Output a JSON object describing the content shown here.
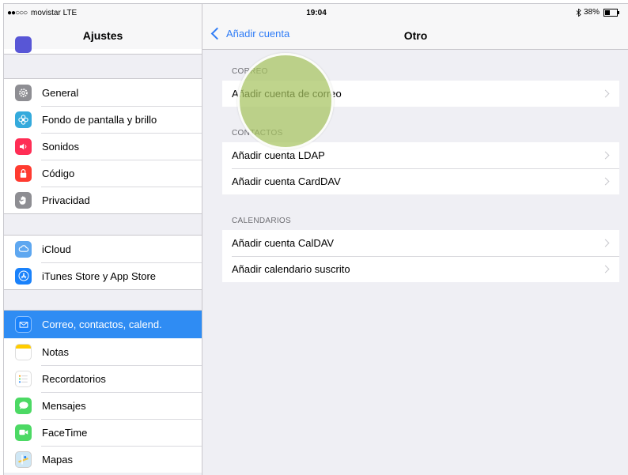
{
  "status_bar": {
    "carrier": "movistar",
    "network": "LTE",
    "time": "19:04",
    "battery": "38%",
    "battery_level": 0.38
  },
  "left_pane": {
    "title": "Ajustes",
    "groups": [
      {
        "items": [
          {
            "label": "General",
            "icon": "gear-icon",
            "color": "#8e8e93"
          },
          {
            "label": "Fondo de pantalla y brillo",
            "icon": "flower-icon",
            "color": "#34aadc"
          },
          {
            "label": "Sonidos",
            "icon": "speaker-icon",
            "color": "#ff2d55"
          },
          {
            "label": "Código",
            "icon": "lock-icon",
            "color": "#ff3b30"
          },
          {
            "label": "Privacidad",
            "icon": "hand-icon",
            "color": "#8e8e93"
          }
        ]
      },
      {
        "items": [
          {
            "label": "iCloud",
            "icon": "cloud-icon",
            "color": "#5ea7f0"
          },
          {
            "label": "iTunes Store y App Store",
            "icon": "appstore-icon",
            "color": "#1a82fb"
          }
        ]
      },
      {
        "items": [
          {
            "label": "Correo, contactos, calend.",
            "icon": "mail-icon",
            "color": "#1a82fb",
            "selected": true
          },
          {
            "label": "Notas",
            "icon": "notes-icon",
            "color": "#ffcc00"
          },
          {
            "label": "Recordatorios",
            "icon": "reminders-icon",
            "color": "#ffffff"
          },
          {
            "label": "Mensajes",
            "icon": "messages-icon",
            "color": "#4cd964"
          },
          {
            "label": "FaceTime",
            "icon": "facetime-icon",
            "color": "#4cd964"
          },
          {
            "label": "Mapas",
            "icon": "maps-icon",
            "color": "#8fc9f0"
          }
        ]
      }
    ]
  },
  "right_pane": {
    "back_label": "Añadir cuenta",
    "title": "Otro",
    "sections": [
      {
        "header": "CORREO",
        "rows": [
          "Añadir cuenta de correo"
        ]
      },
      {
        "header": "CONTACTOS",
        "rows": [
          "Añadir cuenta LDAP",
          "Añadir cuenta CardDAV"
        ]
      },
      {
        "header": "CALENDARIOS",
        "rows": [
          "Añadir cuenta CalDAV",
          "Añadir calendario suscrito"
        ]
      }
    ]
  },
  "colors": {
    "accent": "#2f7cf6",
    "selected_row": "#2f8cf3",
    "background": "#efeff4"
  }
}
